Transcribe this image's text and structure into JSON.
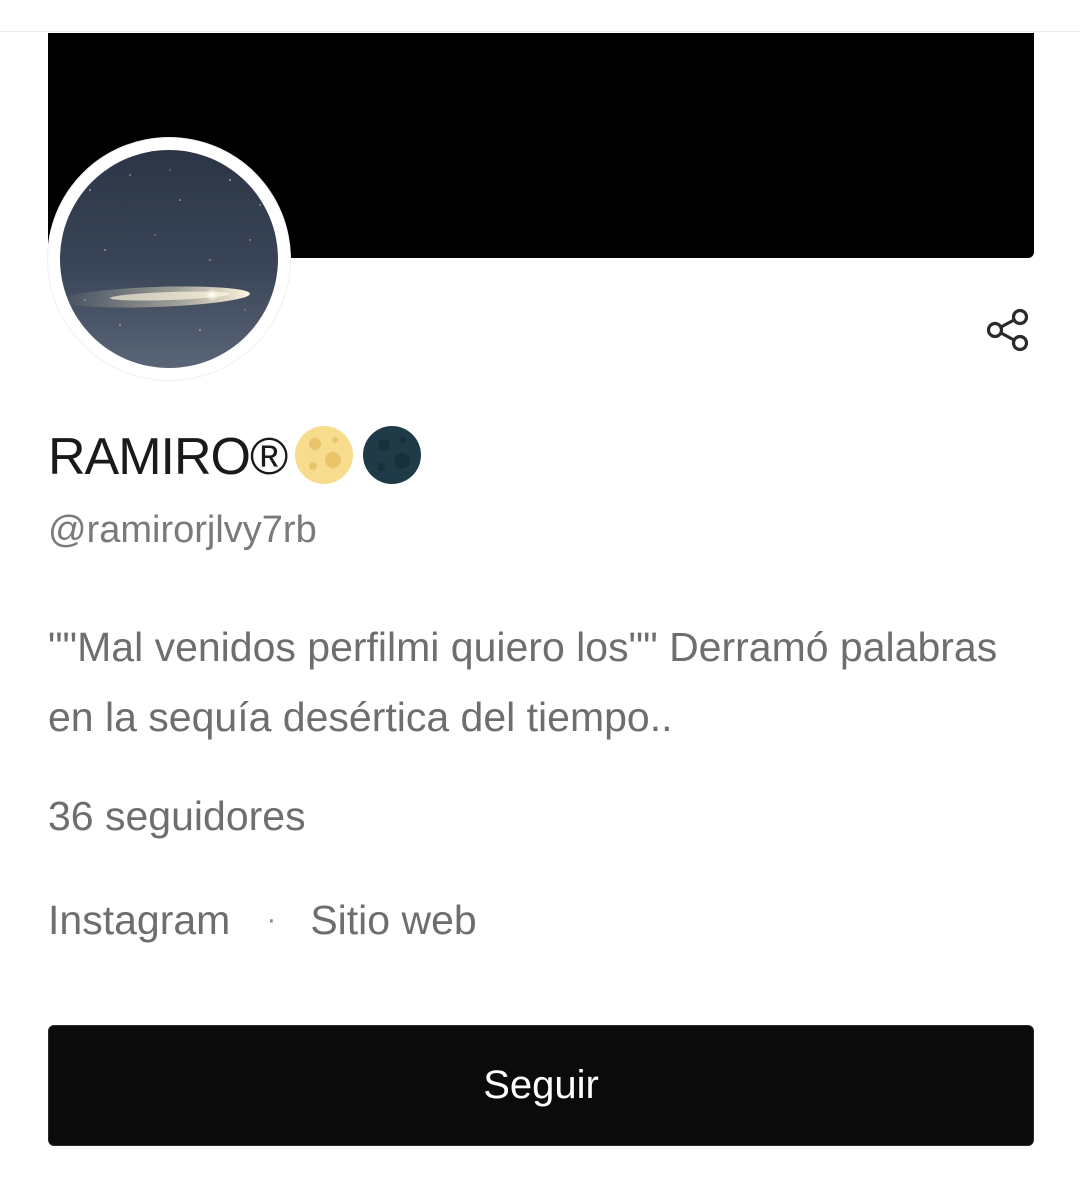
{
  "profile": {
    "name": "RAMIRO®",
    "handle": "@ramirorjlvy7rb",
    "bio": "\"\"Mal venidos perfilmi quiero los\"\" Derramó palabras en la sequía desértica del tiempo..",
    "followers": "36 seguidores",
    "name_emojis": [
      "full-moon-icon",
      "new-moon-icon"
    ]
  },
  "links": {
    "instagram": "Instagram",
    "separator": "·",
    "website": "Sitio web"
  },
  "actions": {
    "follow_label": "Seguir",
    "share_icon": "share-icon"
  },
  "colors": {
    "banner": "#000000",
    "button_bg": "#0b0b0b",
    "button_text": "#ffffff",
    "secondary_text": "#6e6e6e"
  }
}
